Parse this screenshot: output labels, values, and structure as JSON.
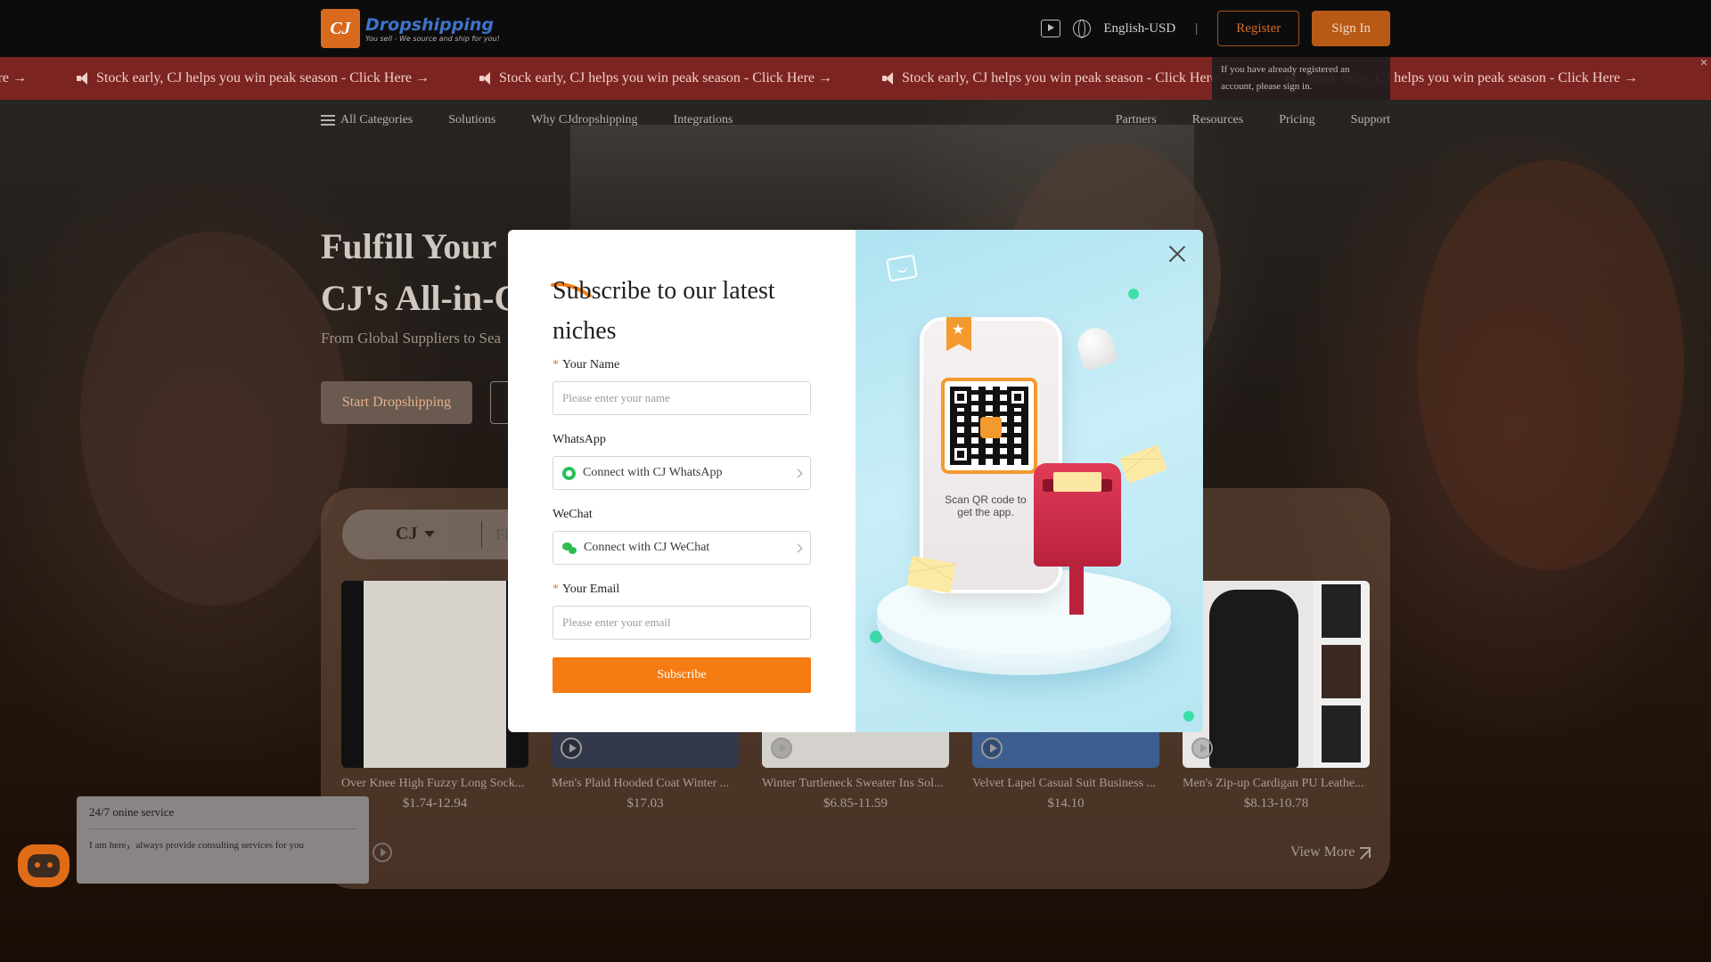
{
  "header": {
    "logo_mark": "CJ",
    "logo_name": "Dropshipping",
    "logo_tagline": "You sell - We source and ship for you!",
    "locale": "English-USD",
    "separator": "|",
    "register_label": "Register",
    "signin_label": "Sign In",
    "tooltip": "If you have already registered an account, please sign in."
  },
  "marquee": {
    "items": [
      "Stock early, CJ helps you win peak season - Click Here →",
      "Stock early, CJ helps you win peak season - Click Here →",
      "Stock early, CJ helps you win peak season - Click Here →",
      "Stock early, CJ helps you win peak season - Click Here →",
      "Stock early, CJ helps you win peak season - Click Here →"
    ]
  },
  "nav": {
    "left": [
      "All Categories",
      "Solutions",
      "Why CJdropshipping",
      "Integrations"
    ],
    "right": [
      "Partners",
      "Resources",
      "Pricing",
      "Support"
    ]
  },
  "hero": {
    "title_line1": "Fulfill Your",
    "title_line2": "CJ's All-in-C",
    "subtitle": "From Global Suppliers to Sea",
    "start_button": "Start Dropshipping"
  },
  "search": {
    "source": "CJ",
    "hint": "Fi"
  },
  "products": [
    {
      "title": "Over Knee High Fuzzy Long Sock...",
      "price": "$1.74-12.94"
    },
    {
      "title": "Men's Plaid Hooded Coat Winter ...",
      "price": "$17.03"
    },
    {
      "title": "Winter Turtleneck Sweater Ins Sol...",
      "price": "$6.85-11.59"
    },
    {
      "title": "Velvet Lapel Casual Suit Business ...",
      "price": "$14.10"
    },
    {
      "title": "Men's Zip-up Cardigan PU Leathe...",
      "price": "$8.13-10.78"
    }
  ],
  "view_more": "View More",
  "chat": {
    "title": "24/7 onine service",
    "message": "I am here，always provide consulting services for you"
  },
  "modal": {
    "title": "Subscribe to our latest niches",
    "name_label": "Your Name",
    "name_placeholder": "Please enter your name",
    "whatsapp_label": "WhatsApp",
    "whatsapp_button": "Connect with CJ WhatsApp",
    "wechat_label": "WeChat",
    "wechat_button": "Connect with CJ WeChat",
    "email_label": "Your Email",
    "email_placeholder": "Please enter your email",
    "required_mark": "*",
    "subscribe_button": "Subscribe",
    "scan_text": "Scan QR code to get the app.",
    "accent_color": "#f57c12"
  }
}
